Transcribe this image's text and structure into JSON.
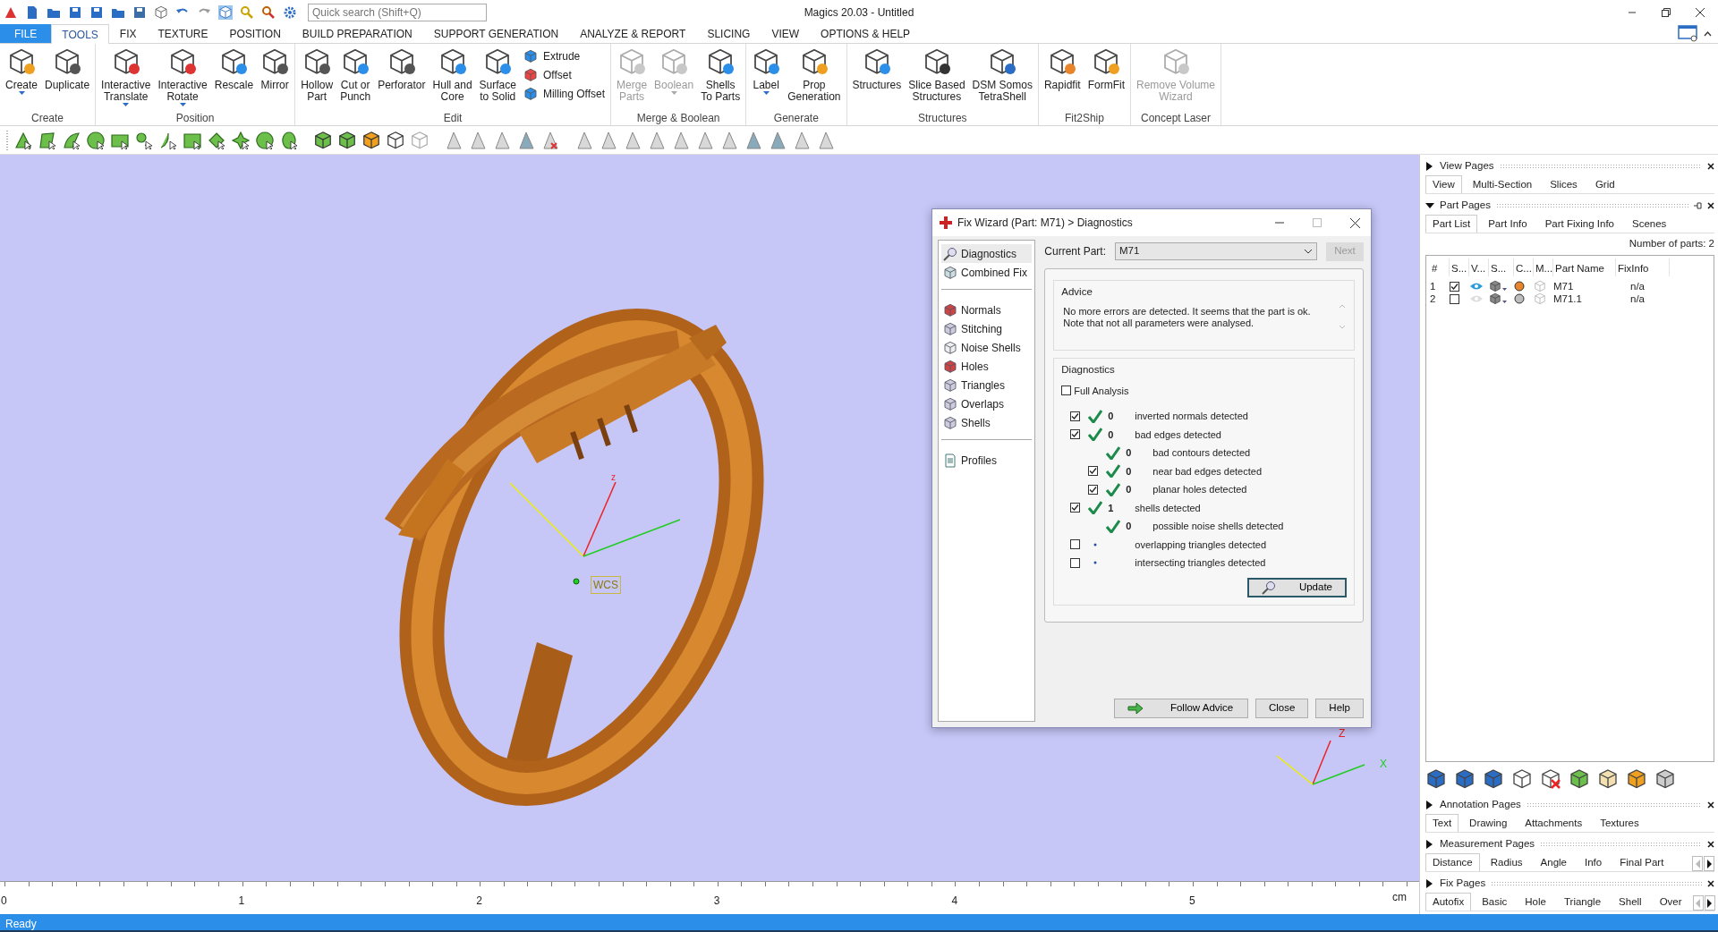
{
  "window": {
    "title": "Magics 20.03 - Untitled",
    "search": {
      "placeholder": "Quick search (Shift+Q)"
    }
  },
  "ribbon": {
    "tabs": [
      {
        "label": "FILE",
        "kind": "file",
        "selected": false
      },
      {
        "label": "TOOLS",
        "kind": "tab",
        "selected": true
      },
      {
        "label": "FIX",
        "kind": "tab",
        "selected": false
      },
      {
        "label": "TEXTURE",
        "kind": "tab",
        "selected": false
      },
      {
        "label": "POSITION",
        "kind": "tab",
        "selected": false
      },
      {
        "label": "BUILD PREPARATION",
        "kind": "tab",
        "selected": false
      },
      {
        "label": "SUPPORT GENERATION",
        "kind": "tab",
        "selected": false
      },
      {
        "label": "ANALYZE & REPORT",
        "kind": "tab",
        "selected": false
      },
      {
        "label": "SLICING",
        "kind": "tab",
        "selected": false
      },
      {
        "label": "VIEW",
        "kind": "tab",
        "selected": false
      },
      {
        "label": "OPTIONS & HELP",
        "kind": "tab",
        "selected": false
      }
    ],
    "groups": [
      {
        "label": "Create",
        "buttons": [
          {
            "kind": "big",
            "lines": [
              "Create"
            ],
            "menu": true,
            "disabled": false
          },
          {
            "kind": "big",
            "lines": [
              "Duplicate"
            ],
            "menu": false,
            "disabled": false
          }
        ]
      },
      {
        "label": "Position",
        "buttons": [
          {
            "kind": "big",
            "lines": [
              "Interactive",
              "Translate"
            ],
            "menu": true,
            "disabled": false
          },
          {
            "kind": "big",
            "lines": [
              "Interactive",
              "Rotate"
            ],
            "menu": true,
            "disabled": false
          },
          {
            "kind": "big",
            "lines": [
              "Rescale"
            ],
            "menu": false,
            "disabled": false
          },
          {
            "kind": "big",
            "lines": [
              "Mirror"
            ],
            "menu": false,
            "disabled": false
          }
        ]
      },
      {
        "label": "Edit",
        "buttons": [
          {
            "kind": "big",
            "lines": [
              "Hollow",
              "Part"
            ],
            "menu": false,
            "disabled": false
          },
          {
            "kind": "big",
            "lines": [
              "Cut or",
              "Punch"
            ],
            "menu": false,
            "disabled": false
          },
          {
            "kind": "big",
            "lines": [
              "Perforator"
            ],
            "menu": false,
            "disabled": false
          },
          {
            "kind": "big",
            "lines": [
              "Hull and",
              "Core"
            ],
            "menu": false,
            "disabled": false
          },
          {
            "kind": "big",
            "lines": [
              "Surface",
              "to Solid"
            ],
            "menu": false,
            "disabled": false
          },
          {
            "kind": "small",
            "lines": [
              "Extrude"
            ],
            "menu": false,
            "disabled": false
          },
          {
            "kind": "small",
            "lines": [
              "Offset"
            ],
            "menu": false,
            "disabled": false
          },
          {
            "kind": "small",
            "lines": [
              "Milling Offset"
            ],
            "menu": false,
            "disabled": false
          }
        ]
      },
      {
        "label": "Merge & Boolean",
        "buttons": [
          {
            "kind": "big",
            "lines": [
              "Merge",
              "Parts"
            ],
            "menu": false,
            "disabled": true
          },
          {
            "kind": "big",
            "lines": [
              "Boolean"
            ],
            "menu": true,
            "disabled": true
          },
          {
            "kind": "big",
            "lines": [
              "Shells",
              "To Parts"
            ],
            "menu": false,
            "disabled": false
          }
        ]
      },
      {
        "label": "Generate",
        "buttons": [
          {
            "kind": "big",
            "lines": [
              "Label"
            ],
            "menu": true,
            "disabled": false
          },
          {
            "kind": "big",
            "lines": [
              "Prop",
              "Generation"
            ],
            "menu": false,
            "disabled": false
          }
        ]
      },
      {
        "label": "Structures",
        "buttons": [
          {
            "kind": "big",
            "lines": [
              "Structures"
            ],
            "menu": false,
            "disabled": false
          },
          {
            "kind": "big",
            "lines": [
              "Slice Based",
              "Structures"
            ],
            "menu": false,
            "disabled": false
          },
          {
            "kind": "big",
            "lines": [
              "DSM Somos",
              "TetraShell"
            ],
            "menu": false,
            "disabled": false
          }
        ]
      },
      {
        "label": "Fit2Ship",
        "buttons": [
          {
            "kind": "big",
            "lines": [
              "Rapidfit"
            ],
            "menu": false,
            "disabled": false
          },
          {
            "kind": "big",
            "lines": [
              "FormFit"
            ],
            "menu": false,
            "disabled": false
          }
        ]
      },
      {
        "label": "Concept Laser",
        "buttons": [
          {
            "kind": "big",
            "lines": [
              "Remove Volume",
              "Wizard"
            ],
            "menu": false,
            "disabled": true
          }
        ]
      }
    ]
  },
  "viewport": {
    "wcs_label": "WCS",
    "wcs_axis": "z",
    "corner_axes": [
      "Z",
      "X"
    ]
  },
  "ruler": {
    "labels": [
      "0",
      "1",
      "2",
      "3",
      "4",
      "5"
    ],
    "unit": "cm"
  },
  "dialog": {
    "title": "Fix Wizard (Part: M71) > Diagnostics",
    "nav": [
      {
        "items": [
          {
            "label": "Diagnostics",
            "selected": true
          },
          {
            "label": "Combined Fix",
            "selected": false
          }
        ]
      },
      {
        "items": [
          {
            "label": "Normals",
            "selected": false
          },
          {
            "label": "Stitching",
            "selected": false
          },
          {
            "label": "Noise Shells",
            "selected": false
          },
          {
            "label": "Holes",
            "selected": false
          },
          {
            "label": "Triangles",
            "selected": false
          },
          {
            "label": "Overlaps",
            "selected": false
          },
          {
            "label": "Shells",
            "selected": false
          }
        ]
      },
      {
        "items": [
          {
            "label": "Profiles",
            "selected": false
          }
        ]
      }
    ],
    "current_part_label": "Current Part:",
    "current_part": "M71",
    "next": {
      "label": "Next",
      "disabled": true
    },
    "advice": {
      "title": "Advice",
      "lines": [
        "No more errors are detected. It seems that the part is ok.",
        "Note that not all parameters were analysed."
      ]
    },
    "diagnostics": {
      "title": "Diagnostics",
      "full_analysis": {
        "label": "Full Analysis",
        "checked": false
      },
      "checks": [
        {
          "kind": "checkbox",
          "checked": true,
          "passed": true,
          "count": "0",
          "label": "inverted normals detected"
        },
        {
          "kind": "checkbox",
          "checked": true,
          "passed": true,
          "count": "0",
          "label": "bad edges detected",
          "children": [
            {
              "kind": "plain",
              "passed": true,
              "count": "0",
              "label": "bad contours detected"
            },
            {
              "kind": "checkbox",
              "checked": true,
              "passed": true,
              "count": "0",
              "label": "near bad edges detected"
            },
            {
              "kind": "checkbox",
              "checked": true,
              "passed": true,
              "count": "0",
              "label": "planar holes detected"
            }
          ]
        },
        {
          "kind": "checkbox",
          "checked": true,
          "passed": true,
          "count": "1",
          "label": "shells detected",
          "children": [
            {
              "kind": "plain",
              "passed": true,
              "count": "0",
              "label": "possible noise shells detected"
            }
          ]
        },
        {
          "kind": "checkbox",
          "checked": false,
          "passed": false,
          "label": "overlapping triangles detected"
        },
        {
          "kind": "checkbox",
          "checked": false,
          "passed": false,
          "label": "intersecting triangles detected"
        }
      ],
      "update_button": "Update"
    },
    "buttons": [
      {
        "kind": "advice",
        "label": "Follow Advice"
      },
      {
        "kind": "plain",
        "label": "Close"
      },
      {
        "kind": "plain",
        "label": "Help"
      }
    ]
  },
  "side_panels": [
    {
      "title": "View Pages",
      "expanded": false,
      "pinnable": false,
      "scroll_arrows": false,
      "tabs": [
        {
          "label": "View",
          "selected": true
        },
        {
          "label": "Multi-Section",
          "selected": false
        },
        {
          "label": "Slices",
          "selected": false
        },
        {
          "label": "Grid",
          "selected": false
        }
      ]
    },
    {
      "title": "Part Pages",
      "expanded": true,
      "pinnable": true,
      "scroll_arrows": false,
      "tabs": [
        {
          "label": "Part List",
          "selected": true
        },
        {
          "label": "Part Info",
          "selected": false
        },
        {
          "label": "Part Fixing Info",
          "selected": false
        },
        {
          "label": "Scenes",
          "selected": false
        }
      ],
      "parts_count": "Number of parts: 2",
      "part_list": {
        "columns": [
          "#",
          "S...",
          "V...",
          "S...",
          "C...",
          "M...",
          "Part Name",
          "FixInfo"
        ],
        "rows": [
          {
            "number": "1",
            "selected": true,
            "visible": true,
            "color": "#e8852c",
            "name": "M71",
            "fix_info": "n/a"
          },
          {
            "number": "2",
            "selected": false,
            "visible": false,
            "color": "#bdbdbd",
            "name": "M71.1",
            "fix_info": "n/a"
          }
        ]
      }
    },
    {
      "title": "Annotation Pages",
      "expanded": false,
      "pinnable": false,
      "scroll_arrows": false,
      "tabs": [
        {
          "label": "Text",
          "selected": true
        },
        {
          "label": "Drawing",
          "selected": false
        },
        {
          "label": "Attachments",
          "selected": false
        },
        {
          "label": "Textures",
          "selected": false
        }
      ]
    },
    {
      "title": "Measurement Pages",
      "expanded": false,
      "pinnable": false,
      "scroll_arrows": true,
      "tabs": [
        {
          "label": "Distance",
          "selected": true
        },
        {
          "label": "Radius",
          "selected": false
        },
        {
          "label": "Angle",
          "selected": false
        },
        {
          "label": "Info",
          "selected": false
        },
        {
          "label": "Final Part",
          "selected": false
        }
      ]
    },
    {
      "title": "Fix Pages",
      "expanded": false,
      "pinnable": false,
      "scroll_arrows": true,
      "tabs": [
        {
          "label": "Autofix",
          "selected": true
        },
        {
          "label": "Basic",
          "selected": false
        },
        {
          "label": "Hole",
          "selected": false
        },
        {
          "label": "Triangle",
          "selected": false
        },
        {
          "label": "Shell",
          "selected": false
        },
        {
          "label": "Over",
          "selected": false
        }
      ]
    }
  ],
  "status_bar": {
    "text": "Ready"
  }
}
